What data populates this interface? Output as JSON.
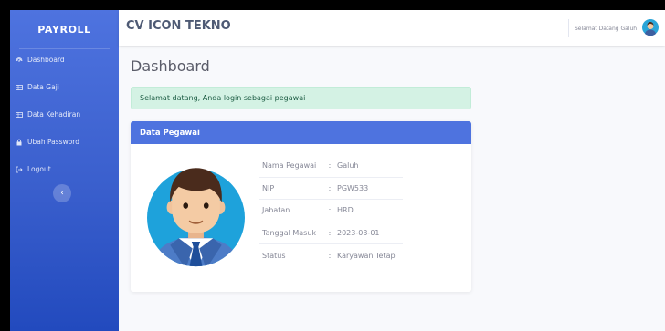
{
  "sidebar": {
    "brand": "PAYROLL",
    "items": [
      {
        "label": "Dashboard",
        "icon": "dashboard-icon"
      },
      {
        "label": "Data Gaji",
        "icon": "table-icon"
      },
      {
        "label": "Data Kehadiran",
        "icon": "table-icon"
      },
      {
        "label": "Ubah Password",
        "icon": "lock-icon"
      },
      {
        "label": "Logout",
        "icon": "logout-icon"
      }
    ],
    "toggle_icon": "chevron-left-icon"
  },
  "topbar": {
    "title": "CV ICON TEKNO",
    "welcome": "Selamat Datang Galuh",
    "avatar_icon": "user-avatar-icon"
  },
  "main": {
    "heading": "Dashboard",
    "alert": "Selamat datang, Anda login sebagai pegawai",
    "card": {
      "title": "Data Pegawai",
      "rows": [
        {
          "label": "Nama Pegawai",
          "sep": ":",
          "value": "Galuh"
        },
        {
          "label": "NIP",
          "sep": ":",
          "value": "PGW533"
        },
        {
          "label": "Jabatan",
          "sep": ":",
          "value": "HRD"
        },
        {
          "label": "Tanggal Masuk",
          "sep": ":",
          "value": "2023-03-01"
        },
        {
          "label": "Status",
          "sep": ":",
          "value": "Karyawan Tetap"
        }
      ]
    }
  },
  "colors": {
    "primary": "#4e73df",
    "alert_bg": "#d4f2e4",
    "alert_text": "#1c5c43"
  }
}
